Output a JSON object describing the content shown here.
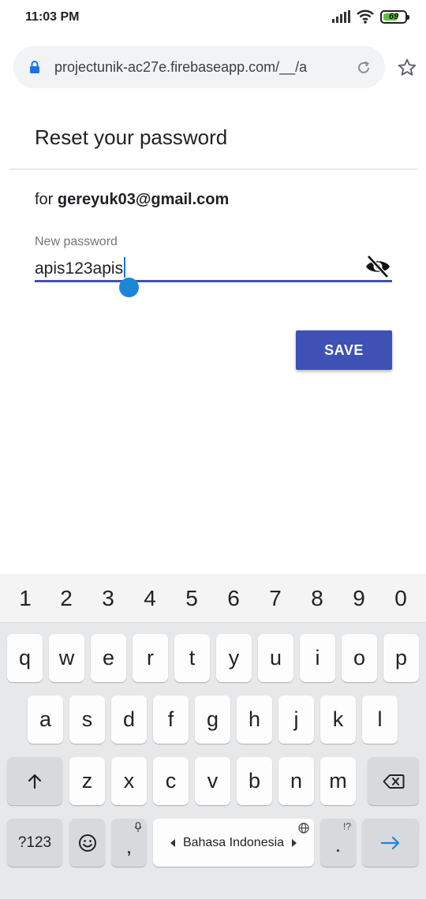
{
  "status": {
    "time": "11:03 PM",
    "battery": "69",
    "battery_level": 0.69
  },
  "browser": {
    "url": "projectunik-ac27e.firebaseapp.com/__/a"
  },
  "page": {
    "title": "Reset your password",
    "for_prefix": "for ",
    "email": "gereyuk03@gmail.com",
    "field_label": "New password",
    "field_value": "apis123apis",
    "save_label": "SAVE"
  },
  "keyboard": {
    "numbers": [
      "1",
      "2",
      "3",
      "4",
      "5",
      "6",
      "7",
      "8",
      "9",
      "0"
    ],
    "row1": [
      "q",
      "w",
      "e",
      "r",
      "t",
      "y",
      "u",
      "i",
      "o",
      "p"
    ],
    "row2": [
      "a",
      "s",
      "d",
      "f",
      "g",
      "h",
      "j",
      "k",
      "l"
    ],
    "row3": [
      "z",
      "x",
      "c",
      "v",
      "b",
      "n",
      "m"
    ],
    "symbols_label": "?123",
    "comma": ",",
    "period": ".",
    "punct_hint": "!?",
    "space_label": "Bahasa Indonesia"
  },
  "icons": {
    "lock": "lock-icon",
    "reload": "reload-icon",
    "star": "star-icon",
    "eye_off": "visibility-off-icon",
    "shift": "shift-icon",
    "backspace": "backspace-icon",
    "emoji": "emoji-icon",
    "mic": "mic-icon",
    "globe": "globe-icon",
    "enter": "arrow-right-icon"
  },
  "colors": {
    "accent": "#3f51b5",
    "lock": "#1a73e8",
    "caret_handle": "#1a88d7",
    "battery_green": "#5cc338",
    "enter_arrow": "#1a88d7"
  }
}
